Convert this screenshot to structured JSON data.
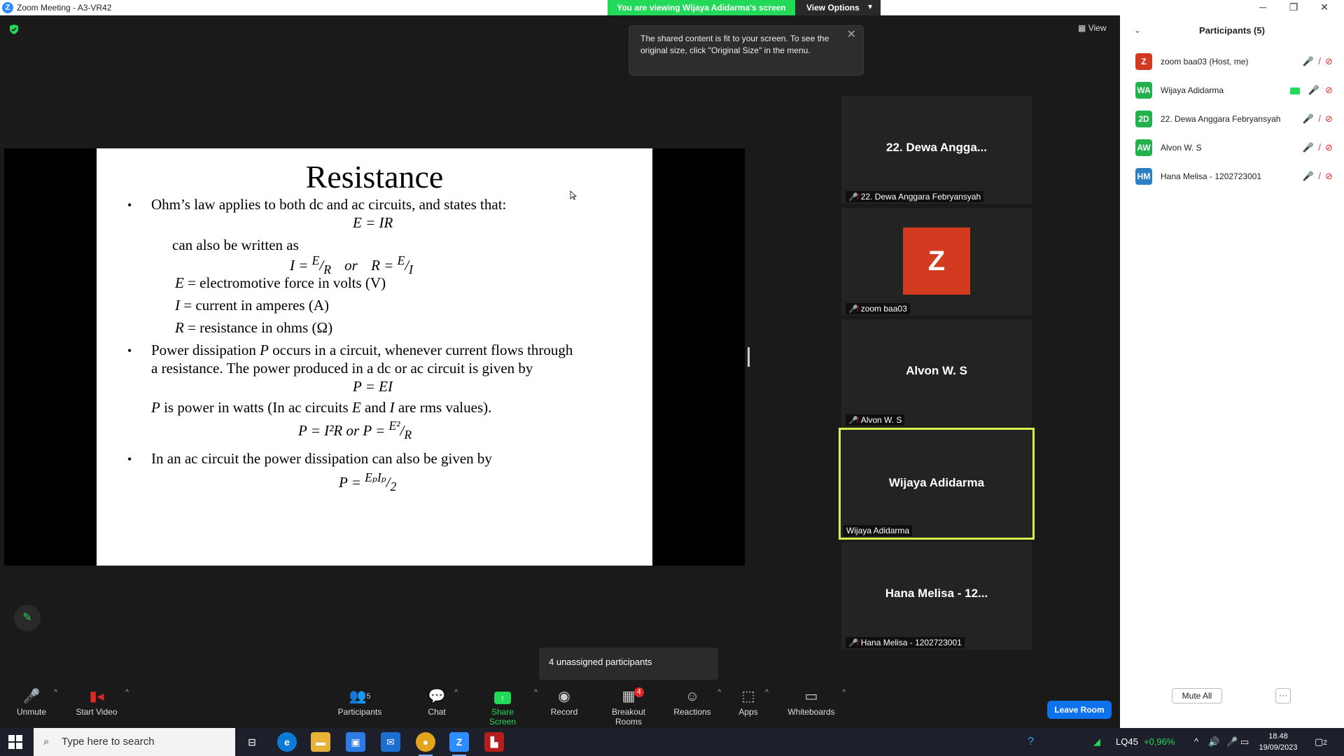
{
  "window": {
    "title": "Zoom Meeting - A3-VR42",
    "minimize": "─",
    "restore": "❐",
    "close": "✕"
  },
  "banner": {
    "viewing": "You are viewing Wijaya Adidarma's screen",
    "view_options": "View Options"
  },
  "view_button": "View",
  "toast": {
    "message": "The shared content is fit to your screen. To see the original size, click \"Original Size\" in the menu."
  },
  "slide": {
    "title": "Resistance",
    "bullet1": "Ohm’s law applies to both dc and ac circuits, and states that:",
    "eq1": "E = IR",
    "also": "can also be written as",
    "eq2_left": "I = ",
    "eq2_or": "or",
    "eq2_right": "R = ",
    "frac_E": "E",
    "frac_R": "R",
    "frac_I": "I",
    "def_E_var": "E",
    "def_E": " = electromotive force in volts (V)",
    "def_I_var": "I",
    "def_I": " = current in amperes (A)",
    "def_R_var": "R",
    "def_R": " = resistance in ohms (Ω)",
    "bullet2_a_pre": "Power dissipation ",
    "bullet2_a_var": "P",
    "bullet2_a_post": " occurs in a circuit, whenever current flows through",
    "bullet2_b": "a resistance. The power produced in a dc or ac circuit is given by",
    "eq3": "P = EI",
    "p_var": "P",
    "p_text1": " is power in watts (In ac circuits ",
    "p_E": "E",
    "p_and": " and ",
    "p_I": "I",
    "p_text2": " are rms values).",
    "eq4": "P = I²R    or P = ",
    "eq4_num": "E²",
    "eq4_den": "R",
    "bullet3": "In an ac circuit the power dissipation can also be given by",
    "eq5": "P = ",
    "eq5_num": "EₚIₚ",
    "eq5_den": "2"
  },
  "tiles": [
    {
      "name": "22. Dewa Angga...",
      "label": "22. Dewa Anggara Febryansyah"
    },
    {
      "avatar": "Z",
      "label": "zoom baa03"
    },
    {
      "name": "Alvon W. S",
      "label": "Alvon W. S"
    },
    {
      "name": "Wijaya Adidarma",
      "label": "Wijaya Adidarma"
    },
    {
      "name": "Hana Melisa - 12...",
      "label": "Hana Melisa - 1202723001"
    }
  ],
  "unassigned": "4 unassigned participants",
  "toolbar": {
    "unmute": "Unmute",
    "start_video": "Start Video",
    "participants": "Participants",
    "participants_count": "5",
    "chat": "Chat",
    "share_screen": "Share Screen",
    "record": "Record",
    "breakout_rooms": "Breakout Rooms",
    "breakout_badge": "4",
    "reactions": "Reactions",
    "apps": "Apps",
    "whiteboards": "Whiteboards",
    "leave_room": "Leave Room"
  },
  "panel": {
    "title": "Participants (5)",
    "participants": [
      {
        "initials": "Z",
        "name": "zoom baa03 (Host, me)",
        "color": "#d23b1f"
      },
      {
        "initials": "WA",
        "name": "Wijaya Adidarma",
        "color": "#23b14d"
      },
      {
        "initials": "2D",
        "name": "22. Dewa Anggara Febryansyah",
        "color": "#23b14d"
      },
      {
        "initials": "AW",
        "name": "Alvon W. S",
        "color": "#23b14d"
      },
      {
        "initials": "HM",
        "name": "Hana Melisa - 1202723001",
        "color": "#2d7fc4"
      }
    ],
    "mute_all": "Mute All",
    "more": "···"
  },
  "taskbar": {
    "search_placeholder": "Type here to search",
    "stock": "LQ45",
    "stock_change": "+0,96%",
    "time": "18.48",
    "date": "19/09/2023",
    "notif_count": "2"
  },
  "colors": {
    "accent_green": "#23d959",
    "leave_blue": "#0e72ed",
    "muted_red": "#e02828",
    "active_border": "#d8f04a"
  }
}
